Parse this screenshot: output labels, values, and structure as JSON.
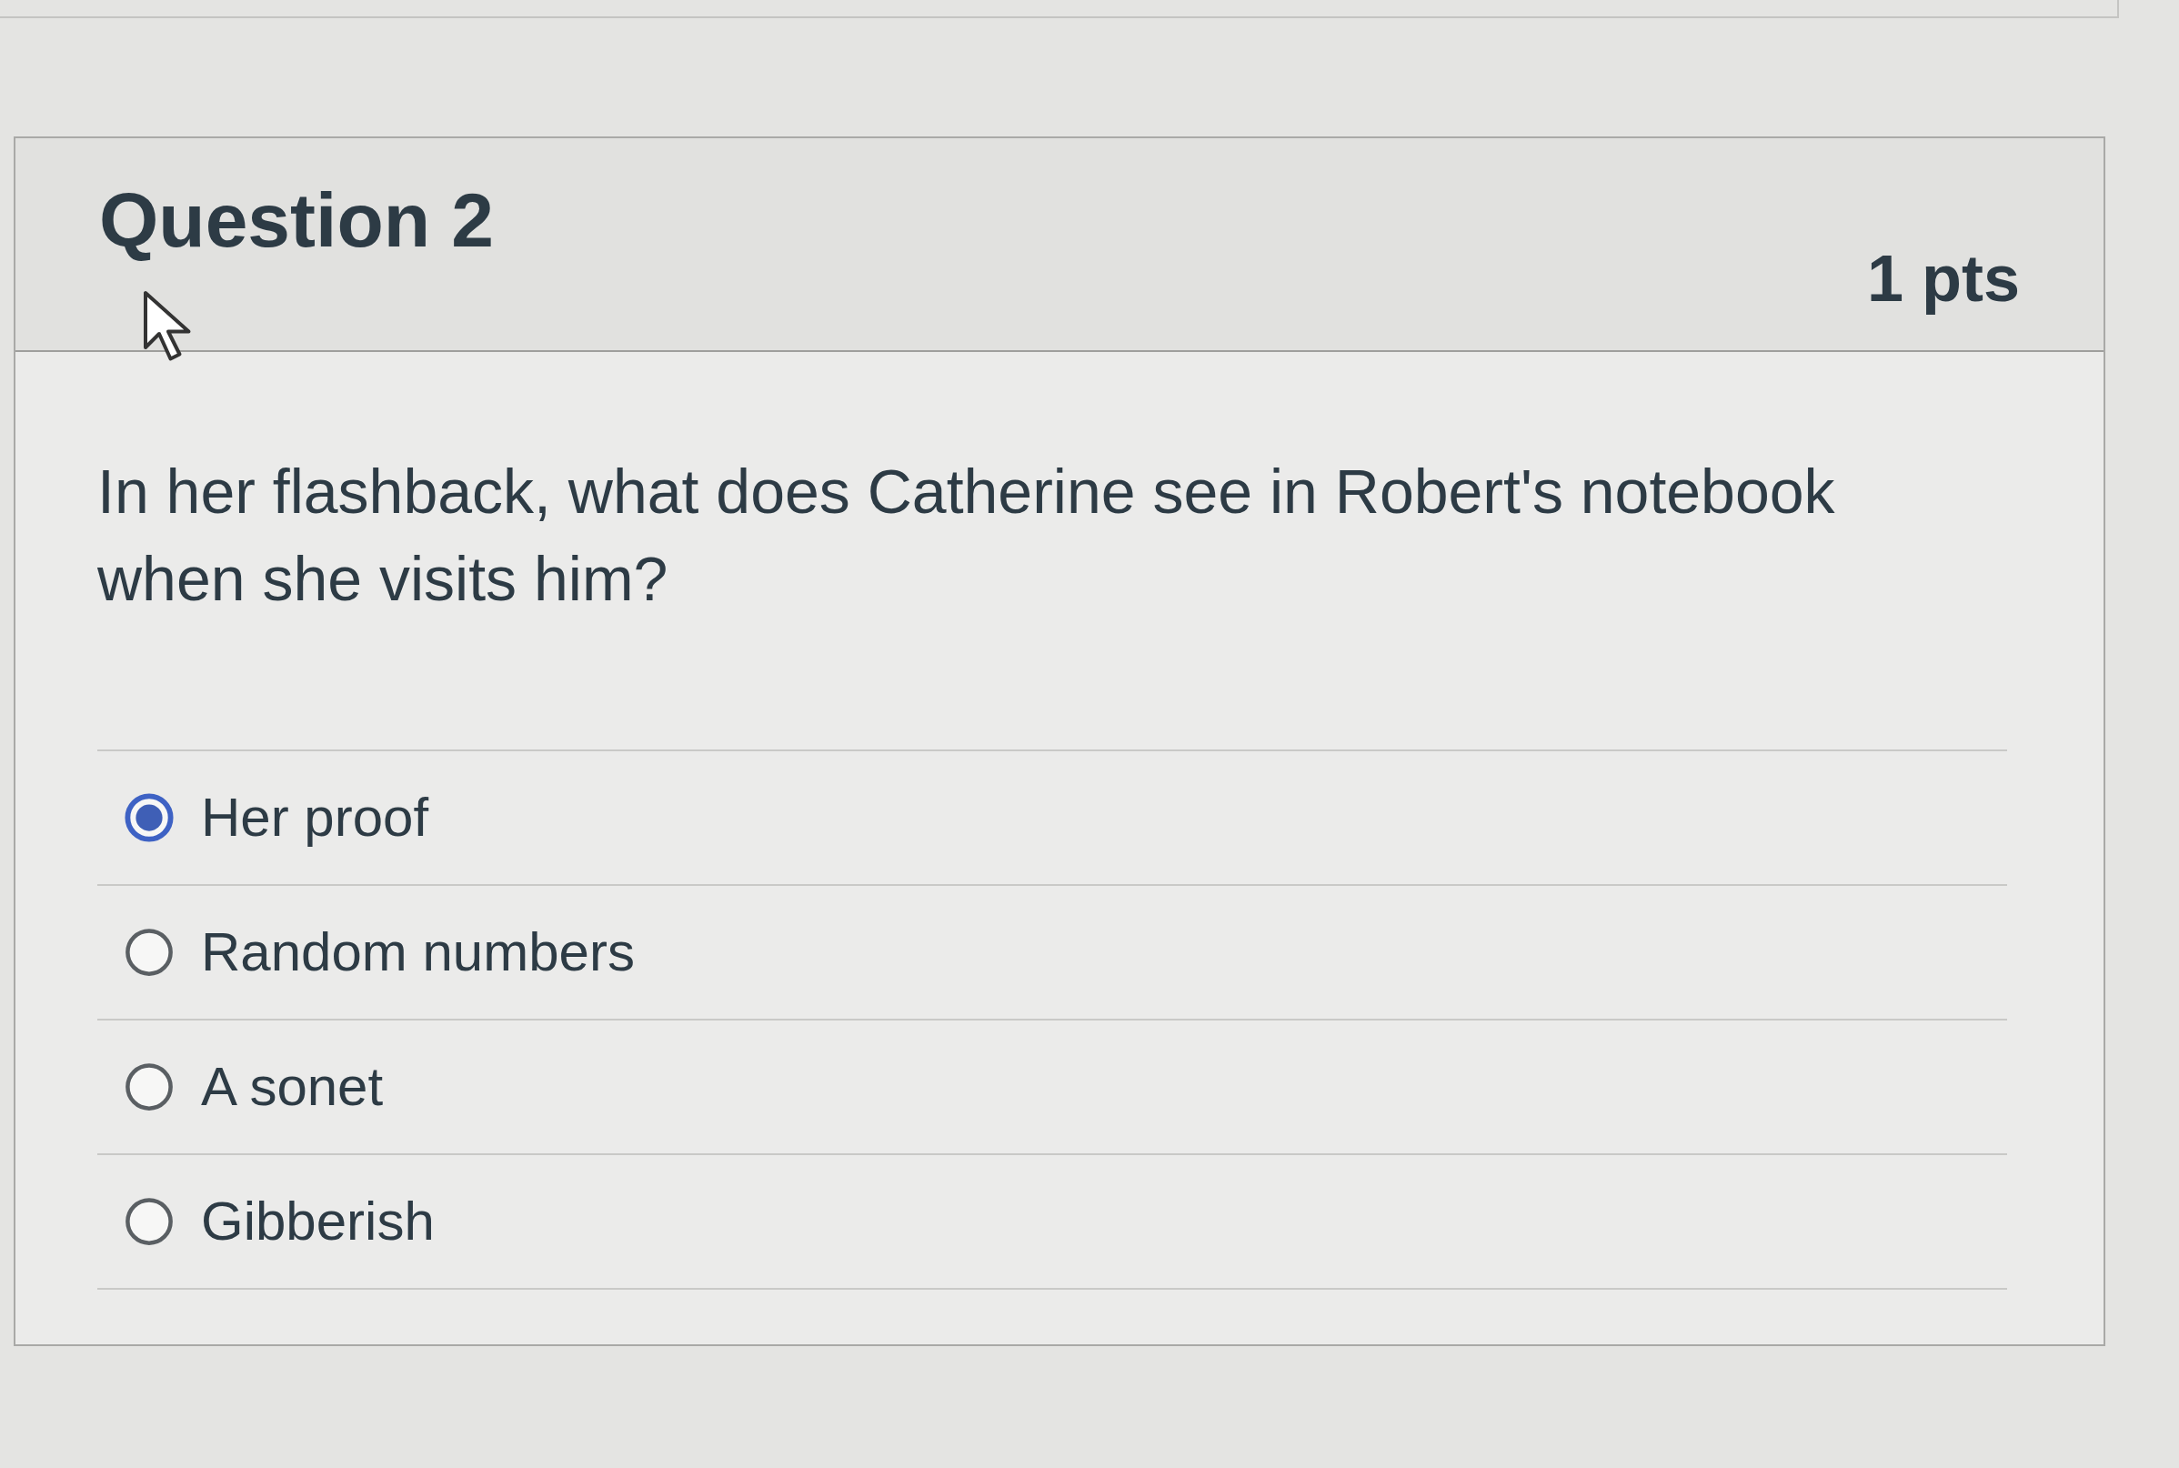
{
  "question": {
    "title": "Question 2",
    "points": "1 pts",
    "text": "In her flashback, what does Catherine see in Robert's notebook when she visits him?",
    "answers": [
      {
        "label": "Her proof",
        "selected": true
      },
      {
        "label": "Random numbers",
        "selected": false
      },
      {
        "label": "A sonet",
        "selected": false
      },
      {
        "label": "Gibberish",
        "selected": false
      }
    ]
  }
}
